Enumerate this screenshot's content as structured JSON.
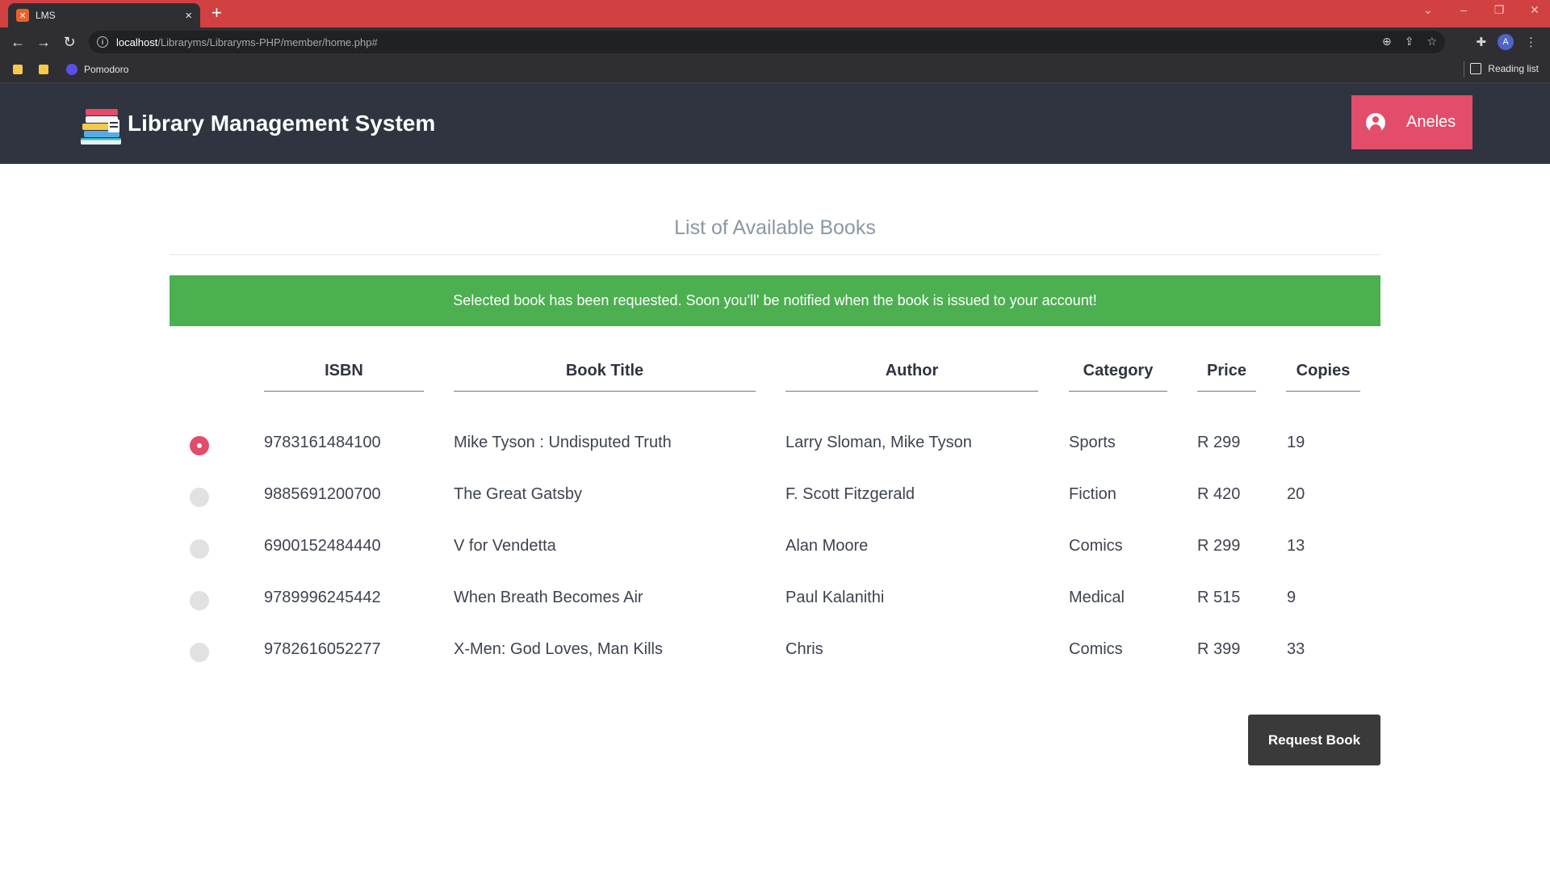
{
  "browser": {
    "tab_title": "LMS",
    "tab_favicon": "xampp-icon",
    "url_host": "localhost",
    "url_path": "/Libraryms/Libraryms-PHP/member/home.php#",
    "profile_initial": "A",
    "bookmarks": {
      "item_label": "Pomodoro",
      "reading_list": "Reading list"
    }
  },
  "header": {
    "title": "Library Management System",
    "user_name": "Aneles"
  },
  "main": {
    "heading": "List of Available Books",
    "alert": "Selected book has been requested. Soon you'll' be notified when the book is issued to your account!",
    "columns": [
      "ISBN",
      "Book Title",
      "Author",
      "Category",
      "Price",
      "Copies"
    ],
    "books": [
      {
        "isbn": "9783161484100",
        "title": "Mike Tyson : Undisputed Truth",
        "author": "Larry Sloman, Mike Tyson",
        "category": "Sports",
        "price": "R 299",
        "copies": "19",
        "selected": true
      },
      {
        "isbn": "9885691200700",
        "title": "The Great Gatsby",
        "author": "F. Scott Fitzgerald",
        "category": "Fiction",
        "price": "R 420",
        "copies": "20",
        "selected": false
      },
      {
        "isbn": "6900152484440",
        "title": "V for Vendetta",
        "author": "Alan Moore",
        "category": "Comics",
        "price": "R 299",
        "copies": "13",
        "selected": false
      },
      {
        "isbn": "9789996245442",
        "title": "When Breath Becomes Air",
        "author": "Paul Kalanithi",
        "category": "Medical",
        "price": "R 515",
        "copies": "9",
        "selected": false
      },
      {
        "isbn": "9782616052277",
        "title": "X-Men: God Loves, Man Kills",
        "author": "Chris",
        "category": "Comics",
        "price": "R 399",
        "copies": "33",
        "selected": false
      }
    ],
    "request_button": "Request Book"
  },
  "colors": {
    "tabbar": "#d24142",
    "header_bg": "#2f3440",
    "accent": "#e34c6a",
    "alert_green": "#4caf50",
    "button_dark": "#3a3a3a"
  }
}
